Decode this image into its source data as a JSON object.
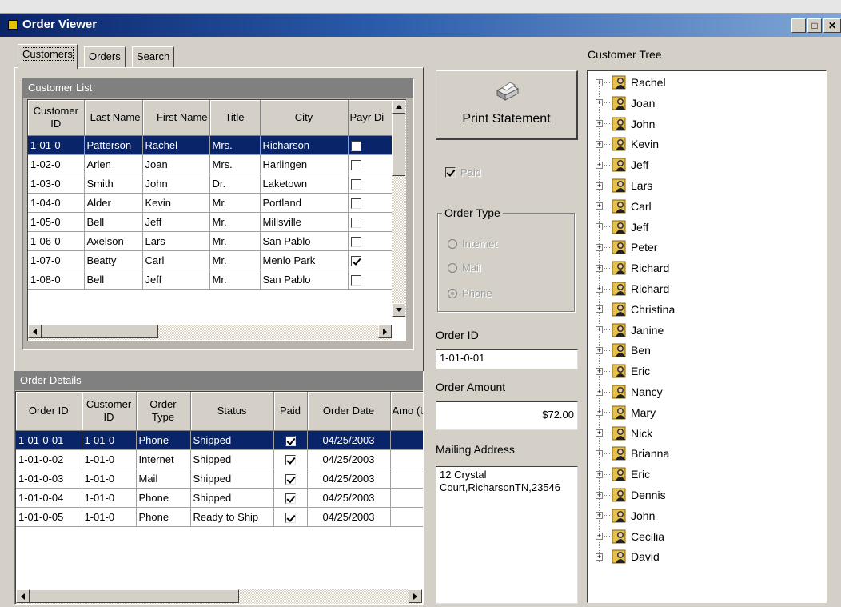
{
  "window": {
    "title": "Order Viewer"
  },
  "tabs": [
    "Customers",
    "Orders",
    "Search"
  ],
  "customer_list": {
    "header": "Customer List",
    "columns": [
      "Customer ID",
      "Last Name",
      "First Name",
      "Title",
      "City",
      "Payr Di"
    ],
    "rows": [
      {
        "id": "1-01-0",
        "last": "Patterson",
        "first": "Rachel",
        "title": "Mrs.",
        "city": "Richarson",
        "paid": false
      },
      {
        "id": "1-02-0",
        "last": "Arlen",
        "first": "Joan",
        "title": "Mrs.",
        "city": "Harlingen",
        "paid": false
      },
      {
        "id": "1-03-0",
        "last": "Smith",
        "first": "John",
        "title": "Dr.",
        "city": "Laketown",
        "paid": false
      },
      {
        "id": "1-04-0",
        "last": "Alder",
        "first": "Kevin",
        "title": "Mr.",
        "city": "Portland",
        "paid": false
      },
      {
        "id": "1-05-0",
        "last": "Bell",
        "first": "Jeff",
        "title": "Mr.",
        "city": "Millsville",
        "paid": false
      },
      {
        "id": "1-06-0",
        "last": "Axelson",
        "first": "Lars",
        "title": "Mr.",
        "city": "San Pablo",
        "paid": false
      },
      {
        "id": "1-07-0",
        "last": "Beatty",
        "first": "Carl",
        "title": "Mr.",
        "city": "Menlo Park",
        "paid": true
      },
      {
        "id": "1-08-0",
        "last": "Bell",
        "first": "Jeff",
        "title": "Mr.",
        "city": "San Pablo",
        "paid": false
      }
    ]
  },
  "order_details": {
    "header": "Order Details",
    "columns": [
      "Order ID",
      "Customer ID",
      "Order Type",
      "Status",
      "Paid",
      "Order Date",
      "Amo (U!"
    ],
    "rows": [
      {
        "order_id": "1-01-0-01",
        "cust": "1-01-0",
        "type": "Phone",
        "status": "Shipped",
        "paid": true,
        "date": "04/25/2003",
        "amt": ""
      },
      {
        "order_id": "1-01-0-02",
        "cust": "1-01-0",
        "type": "Internet",
        "status": "Shipped",
        "paid": true,
        "date": "04/25/2003",
        "amt": "!"
      },
      {
        "order_id": "1-01-0-03",
        "cust": "1-01-0",
        "type": "Mail",
        "status": "Shipped",
        "paid": true,
        "date": "04/25/2003",
        "amt": "$:"
      },
      {
        "order_id": "1-01-0-04",
        "cust": "1-01-0",
        "type": "Phone",
        "status": "Shipped",
        "paid": true,
        "date": "04/25/2003",
        "amt": "!"
      },
      {
        "order_id": "1-01-0-05",
        "cust": "1-01-0",
        "type": "Phone",
        "status": "Ready to Ship",
        "paid": true,
        "date": "04/25/2003",
        "amt": "!"
      }
    ]
  },
  "actions": {
    "print_statement": "Print Statement"
  },
  "paid_checkbox": {
    "label": "Paid",
    "checked": true
  },
  "order_type": {
    "label": "Order Type",
    "options": [
      "Internet",
      "Mail",
      "Phone"
    ],
    "selected": "Phone"
  },
  "order_id": {
    "label": "Order ID",
    "value": "1-01-0-01"
  },
  "order_amount": {
    "label": "Order Amount",
    "value": "$72.00"
  },
  "mailing_address": {
    "label": "Mailing Address",
    "value": "12 Crystal Court,RicharsonTN,23546"
  },
  "customer_tree": {
    "label": "Customer Tree",
    "items": [
      "Rachel",
      "Joan",
      "John",
      "Kevin",
      "Jeff",
      "Lars",
      "Carl",
      "Jeff",
      "Peter",
      "Richard",
      "Richard",
      "Christina",
      "Janine",
      "Ben",
      "Eric",
      "Nancy",
      "Mary",
      "Nick",
      "Brianna",
      "Eric",
      "Dennis",
      "John",
      "Cecilia",
      "David"
    ]
  },
  "colors": {
    "selection": "#0a246a",
    "titlebar": "#0a246a",
    "face": "#d4d0c8"
  }
}
